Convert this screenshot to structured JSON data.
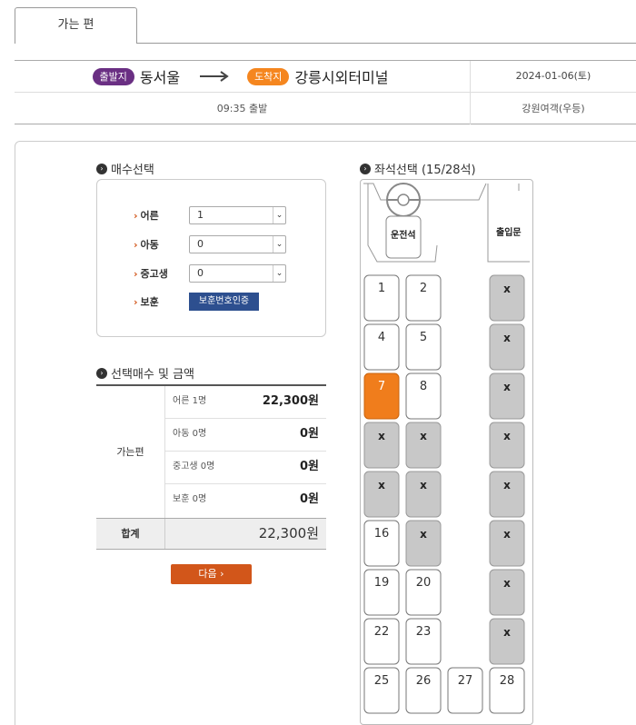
{
  "tab": {
    "label": "가는 편"
  },
  "route": {
    "departure_badge": "출발지",
    "departure": "동서울",
    "arrival_badge": "도착지",
    "arrival": "강릉시외터미널",
    "date": "2024-01-06(토)",
    "departure_time": "09:35 출발",
    "company": "강원여객(우등)"
  },
  "count_section": {
    "title": "매수선택",
    "rows": [
      {
        "label": "어른",
        "value": "1"
      },
      {
        "label": "아동",
        "value": "0"
      },
      {
        "label": "중고생",
        "value": "0"
      }
    ],
    "veteran": {
      "label": "보훈",
      "button": "보훈번호인증"
    }
  },
  "summary": {
    "title": "선택매수 및 금액",
    "direction": "가는편",
    "rows": [
      {
        "name": "어른 1명",
        "price": "22,300원"
      },
      {
        "name": "아동 0명",
        "price": "0원"
      },
      {
        "name": "중고생 0명",
        "price": "0원"
      },
      {
        "name": "보훈 0명",
        "price": "0원"
      }
    ],
    "total_label": "합계",
    "total_value": "22,300원",
    "next_button": "다음"
  },
  "seat_section": {
    "title": "좌석선택 (15/28석)",
    "driver_label": "운전석",
    "door_label": "출입문",
    "seats": [
      {
        "id": "1",
        "label": "1",
        "state": "available"
      },
      {
        "id": "2",
        "label": "2",
        "state": "available"
      },
      {
        "id": "3",
        "label": "x",
        "state": "taken"
      },
      {
        "id": "4",
        "label": "4",
        "state": "available"
      },
      {
        "id": "5",
        "label": "5",
        "state": "available"
      },
      {
        "id": "6",
        "label": "x",
        "state": "taken"
      },
      {
        "id": "7",
        "label": "7",
        "state": "selected"
      },
      {
        "id": "8",
        "label": "8",
        "state": "available"
      },
      {
        "id": "9",
        "label": "x",
        "state": "taken"
      },
      {
        "id": "10",
        "label": "x",
        "state": "taken"
      },
      {
        "id": "11",
        "label": "x",
        "state": "taken"
      },
      {
        "id": "12",
        "label": "x",
        "state": "taken"
      },
      {
        "id": "13",
        "label": "x",
        "state": "taken"
      },
      {
        "id": "14",
        "label": "x",
        "state": "taken"
      },
      {
        "id": "15",
        "label": "x",
        "state": "taken"
      },
      {
        "id": "16",
        "label": "16",
        "state": "available"
      },
      {
        "id": "17",
        "label": "x",
        "state": "taken"
      },
      {
        "id": "18",
        "label": "x",
        "state": "taken"
      },
      {
        "id": "19",
        "label": "19",
        "state": "available"
      },
      {
        "id": "20",
        "label": "20",
        "state": "available"
      },
      {
        "id": "21",
        "label": "x",
        "state": "taken"
      },
      {
        "id": "22",
        "label": "22",
        "state": "available"
      },
      {
        "id": "23",
        "label": "23",
        "state": "available"
      },
      {
        "id": "24",
        "label": "x",
        "state": "taken"
      },
      {
        "id": "25",
        "label": "25",
        "state": "available"
      },
      {
        "id": "26",
        "label": "26",
        "state": "available"
      },
      {
        "id": "27",
        "label": "27",
        "state": "available"
      },
      {
        "id": "28",
        "label": "28",
        "state": "available"
      }
    ]
  },
  "colors": {
    "purple_badge": "#6a2f83",
    "orange_badge": "#f5861f",
    "selected_seat": "#f07d1c",
    "taken_seat": "#c8c8c8",
    "next_button": "#d2561a",
    "verify_button": "#2d4f8f"
  }
}
